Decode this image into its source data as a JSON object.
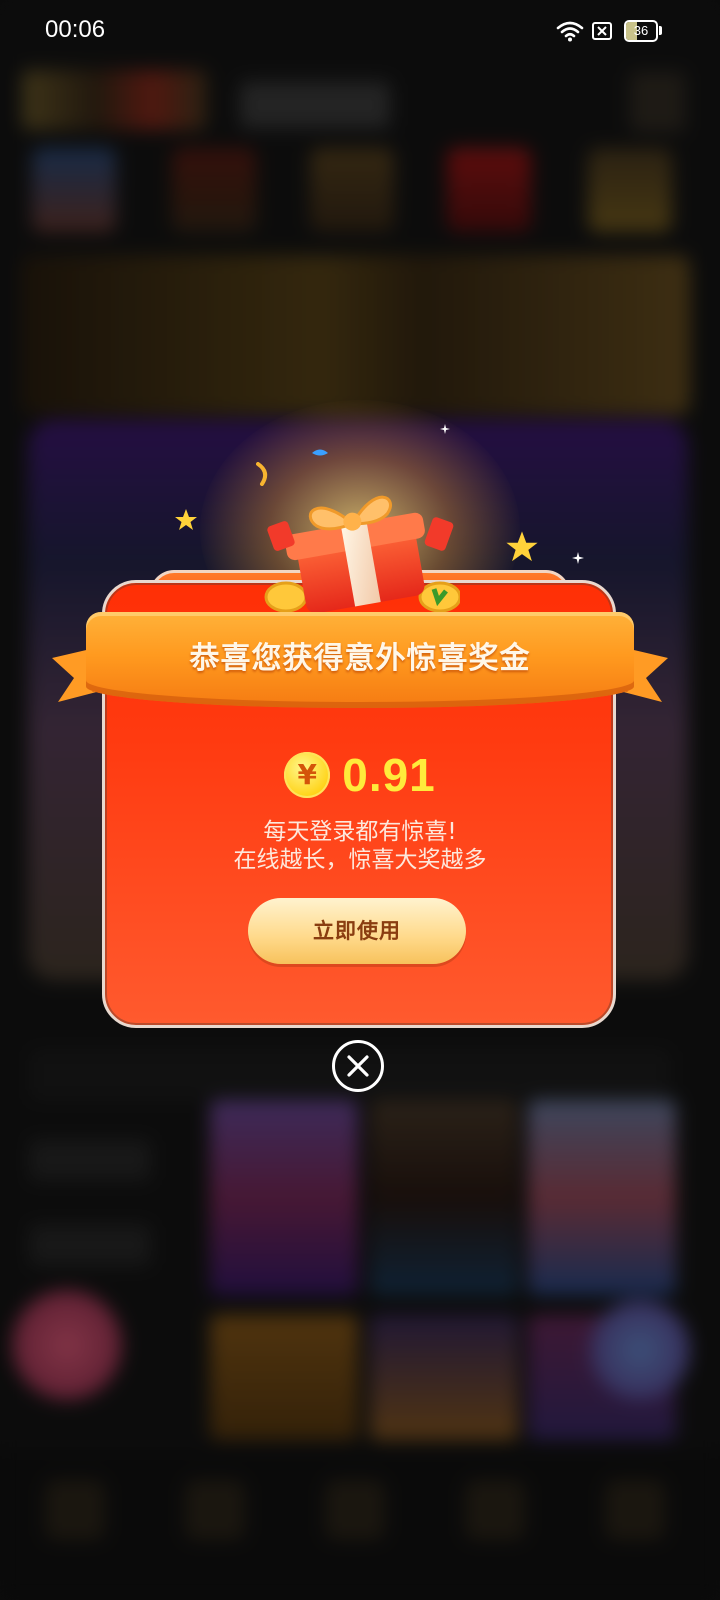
{
  "status_bar": {
    "time": "00:06",
    "battery_level": "36",
    "icons": [
      "wifi-icon",
      "no-sim-icon",
      "battery-icon"
    ]
  },
  "dialog": {
    "title": "恭喜您获得意外惊喜奖金",
    "currency_symbol": "¥",
    "amount": "0.91",
    "message_line1": "每天登录都有惊喜!",
    "message_line2": "在线越长，惊喜大奖越多",
    "use_button_label": "立即使用",
    "close_icon": "close-icon",
    "gift_icon": "gift-box-icon"
  },
  "colors": {
    "card_red": "#ff3a10",
    "ribbon_orange": "#ff9a1f",
    "amount_yellow": "#ffeb3b",
    "button_gold": "#ffd98a",
    "button_text": "#8a3d10"
  }
}
